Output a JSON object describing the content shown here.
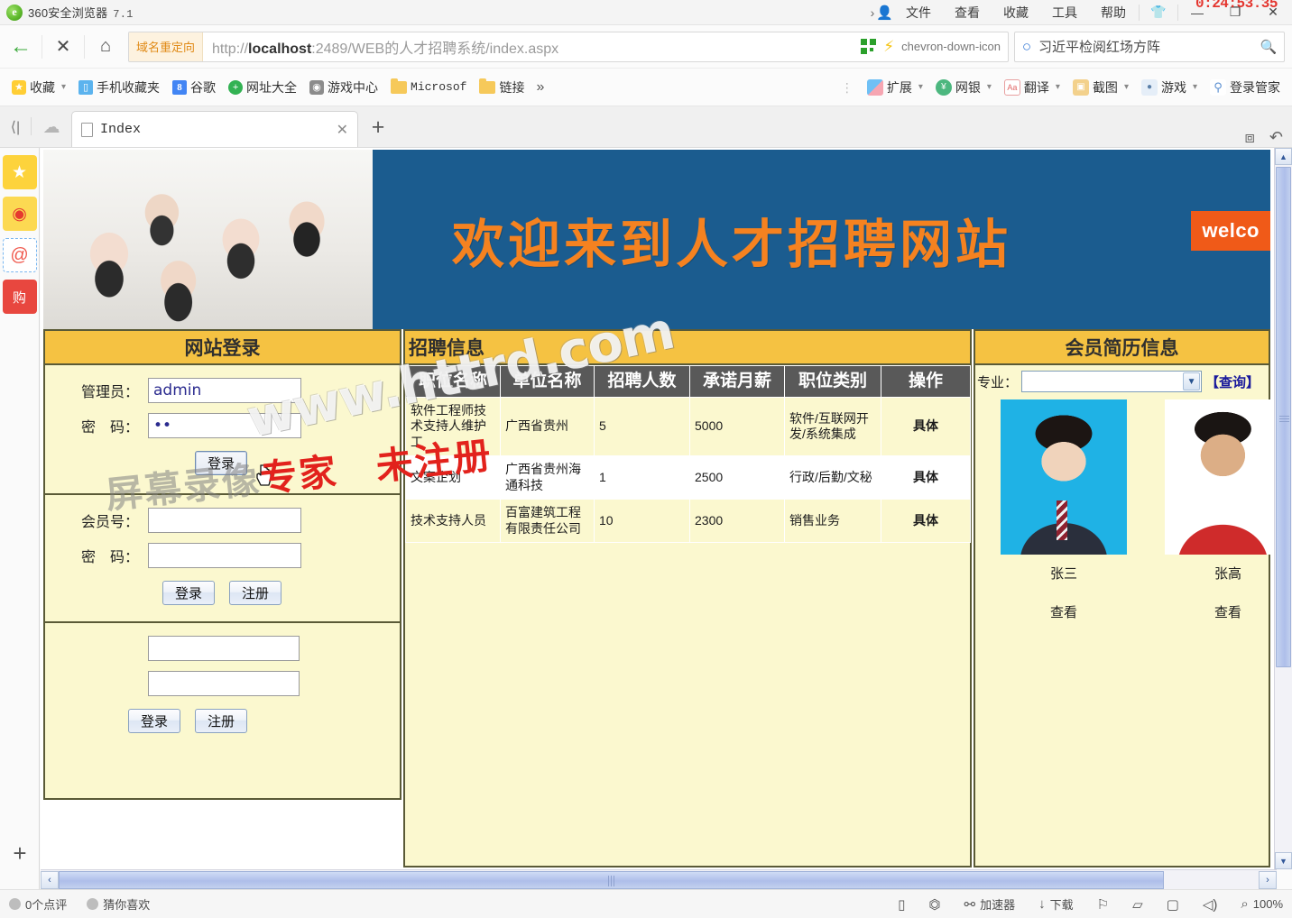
{
  "browser": {
    "app_name": "360安全浏览器",
    "app_version": "7.1",
    "logo_glyph": "e",
    "menus": [
      "文件",
      "查看",
      "收藏",
      "工具",
      "帮助"
    ],
    "user_icon": "person-icon",
    "user_caret": "›",
    "window_buttons": {
      "minimize": "—",
      "maximize": "❐",
      "close": "✕",
      "skin": "👕"
    },
    "recording_timer": "0:24:53.35",
    "nav": {
      "back": "←",
      "stop": "✕",
      "home": "⌂",
      "redirect_tag": "域名重定向",
      "url_prefix": "http://",
      "url_host": "localhost",
      "url_rest": ":2489/WEB的人才招聘系统/index.aspx",
      "qr_icon": "qr-code-icon",
      "bolt_icon": "lightning-icon",
      "chevron_icon": "chevron-down-icon"
    },
    "search": {
      "engine_icon": "search-engine-logo",
      "query": "习近平检阅红场方阵",
      "go_icon": "search-icon"
    },
    "bookmarks": [
      {
        "label": "收藏",
        "icon": "star-icon",
        "caret": "▾"
      },
      {
        "label": "手机收藏夹",
        "icon": "phone-icon"
      },
      {
        "label": "谷歌",
        "icon": "google-icon"
      },
      {
        "label": "网址大全",
        "icon": "plus-circle-icon"
      },
      {
        "label": "游戏中心",
        "icon": "gamepad-icon"
      },
      {
        "label": "Microsof",
        "icon": "folder-icon",
        "mono": true
      },
      {
        "label": "链接",
        "icon": "folder-icon"
      }
    ],
    "bookmarks_more": "»",
    "toolbar_right": [
      {
        "label": "扩展",
        "icon": "extension-icon",
        "caret": "▾"
      },
      {
        "label": "网银",
        "icon": "bank-shield-icon",
        "caret": "▾"
      },
      {
        "label": "翻译",
        "icon": "translate-icon",
        "caret": "▾"
      },
      {
        "label": "截图",
        "icon": "screenshot-icon",
        "caret": "▾"
      },
      {
        "label": "游戏",
        "icon": "game-icon",
        "caret": "▾"
      },
      {
        "label": "登录管家",
        "icon": "key-icon"
      }
    ],
    "tabs": {
      "prev_icon": "tab-prev-icon",
      "cloud_icon": "cloud-icon",
      "items": [
        {
          "title": "Index",
          "favicon": "page-icon",
          "close": "✕"
        }
      ],
      "new_tab": "+",
      "right_icons": [
        "restore-window-icon",
        "undo-icon"
      ]
    },
    "sidebar": [
      {
        "name": "favorites",
        "icon": "star-icon",
        "glyph": "★"
      },
      {
        "name": "weibo",
        "icon": "weibo-eye-icon",
        "glyph": "◉"
      },
      {
        "name": "mail",
        "icon": "at-icon",
        "glyph": "@"
      },
      {
        "name": "shopping",
        "icon": "shopping-bag-icon",
        "glyph": "购"
      }
    ],
    "sidebar_add": "+",
    "statusbar": {
      "left": [
        {
          "label": "0个点评",
          "icon": "comment-icon"
        },
        {
          "label": "猜你喜欢",
          "icon": "dot-icon"
        }
      ],
      "right": [
        {
          "label": "",
          "icon": "phone-preview-icon",
          "glyph": "▯"
        },
        {
          "label": "",
          "icon": "privacy-icon",
          "glyph": "⏣"
        },
        {
          "label": "加速器",
          "icon": "accelerator-icon",
          "glyph": "⚯"
        },
        {
          "label": "下载",
          "icon": "download-icon",
          "glyph": "↓"
        },
        {
          "label": "",
          "icon": "flag-icon",
          "glyph": "⚐"
        },
        {
          "label": "",
          "icon": "shield-icon",
          "glyph": "⏥"
        },
        {
          "label": "",
          "icon": "sidebar-icon",
          "glyph": "▢"
        },
        {
          "label": "",
          "icon": "volume-icon",
          "glyph": "◁)"
        },
        {
          "label": "100%",
          "icon": "zoom-icon",
          "glyph": "⌕"
        }
      ]
    }
  },
  "page": {
    "banner": {
      "photo_alt": "happy-team-photo",
      "headline": "欢迎来到人才招聘网站",
      "welcome_badge": "welco"
    },
    "login_panel": {
      "title": "网站登录",
      "admin_section": {
        "admin_label": "管理员：",
        "admin_value": "admin",
        "password_label": "密　码：",
        "password_value": "••",
        "submit_label": "登录"
      },
      "member_section": {
        "member_label": "会员号：",
        "member_value": "",
        "password_label": "密　码：",
        "password_value": "",
        "login_label": "登录",
        "register_label": "注册"
      },
      "company_section": {
        "field1_value": "",
        "field2_value": "",
        "login_label": "登录",
        "register_label": "注册"
      }
    },
    "recruit_panel": {
      "title": "招聘信息",
      "columns": [
        "职位名称",
        "单位名称",
        "招聘人数",
        "承诺月薪",
        "职位类别",
        "操作"
      ],
      "rows": [
        {
          "position": "软件工程师技术支持人维护工",
          "company": "广西省贵州",
          "headcount": "5",
          "salary": "5000",
          "category": "软件/互联网开发/系统集成",
          "action": "具体"
        },
        {
          "position": "文案企划",
          "company": "广西省贵州海通科技",
          "headcount": "1",
          "salary": "2500",
          "category": "行政/后勤/文秘",
          "action": "具体"
        },
        {
          "position": "技术支持人员",
          "company": "百富建筑工程有限责任公司",
          "headcount": "10",
          "salary": "2300",
          "category": "销售业务",
          "action": "具体"
        }
      ]
    },
    "resume_panel": {
      "title": "会员简历信息",
      "major_label": "专业：",
      "major_value": "",
      "query_label": "【查询】",
      "members": [
        {
          "name": "张三",
          "view_label": "查看",
          "photo": "id-photo-blue-bg"
        },
        {
          "name": "张高",
          "view_label": "查看",
          "photo": "id-photo-white-bg"
        }
      ]
    },
    "watermarks": {
      "site": "www.httrd.com",
      "recorder_gray": "屏幕录像",
      "recorder_red": "专家　未注册"
    },
    "scrollbars": {
      "v_up": "▲",
      "v_down": "▼",
      "h_left": "‹",
      "h_right": "›"
    }
  }
}
